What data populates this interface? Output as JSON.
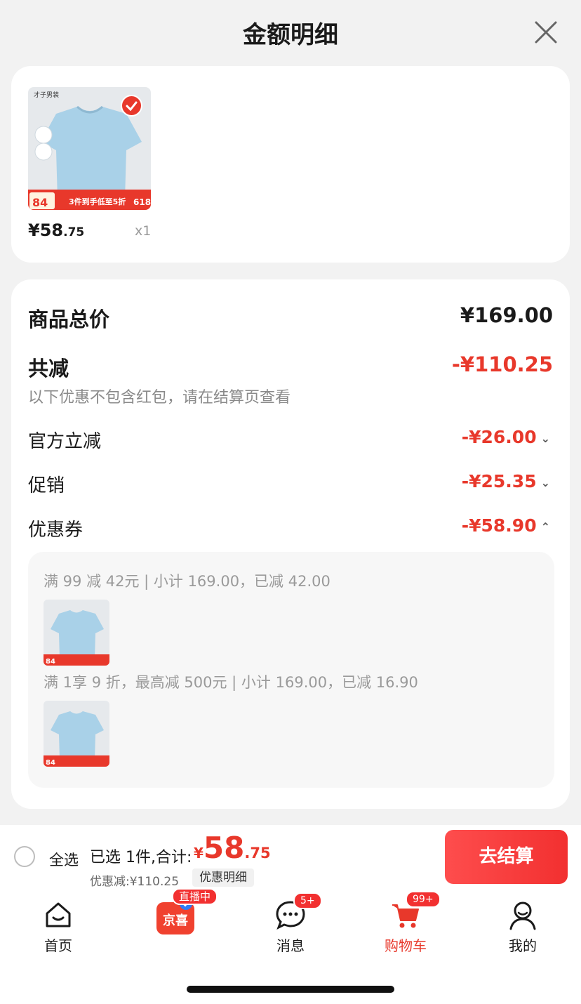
{
  "header": {
    "title": "金额明细"
  },
  "product": {
    "price_int": "¥58",
    "price_dec": ".75",
    "qty": "x1",
    "image_brand": "才子男装",
    "image_promo_price": "84",
    "image_promo_text": "3件到手低至5折",
    "image_badge": "618"
  },
  "summary": {
    "total_label": "商品总价",
    "total_value": "¥169.00",
    "discount_label": "共减",
    "discount_value": "-¥110.25",
    "note": "以下优惠不包含红包，请在结算页查看",
    "items": [
      {
        "label": "官方立减",
        "value": "-¥26.00"
      },
      {
        "label": "促销",
        "value": "-¥25.35"
      },
      {
        "label": "优惠券",
        "value": "-¥58.90"
      }
    ],
    "coupons": [
      {
        "text": "满 99 减 42元 | 小计 169.00，已减 42.00"
      },
      {
        "text": "满 1享 9 折，最高减 500元 | 小计 169.00，已减 16.90"
      }
    ]
  },
  "bottombar": {
    "select_all": "全选",
    "selected": "已选 1件,合计:",
    "currency": "¥",
    "total_int": "58",
    "total_dec": ".75",
    "discount": "优惠减:¥110.25",
    "detail_btn": "优惠明细",
    "checkout": "去结算"
  },
  "tabs": [
    {
      "label": "首页"
    },
    {
      "label": "京喜",
      "badge": "直播中"
    },
    {
      "label": "消息",
      "badge": "5+"
    },
    {
      "label": "购物车",
      "badge": "99+"
    },
    {
      "label": "我的"
    }
  ],
  "colors": {
    "accent": "#e8382b",
    "shirt": "#a9d1e8"
  }
}
